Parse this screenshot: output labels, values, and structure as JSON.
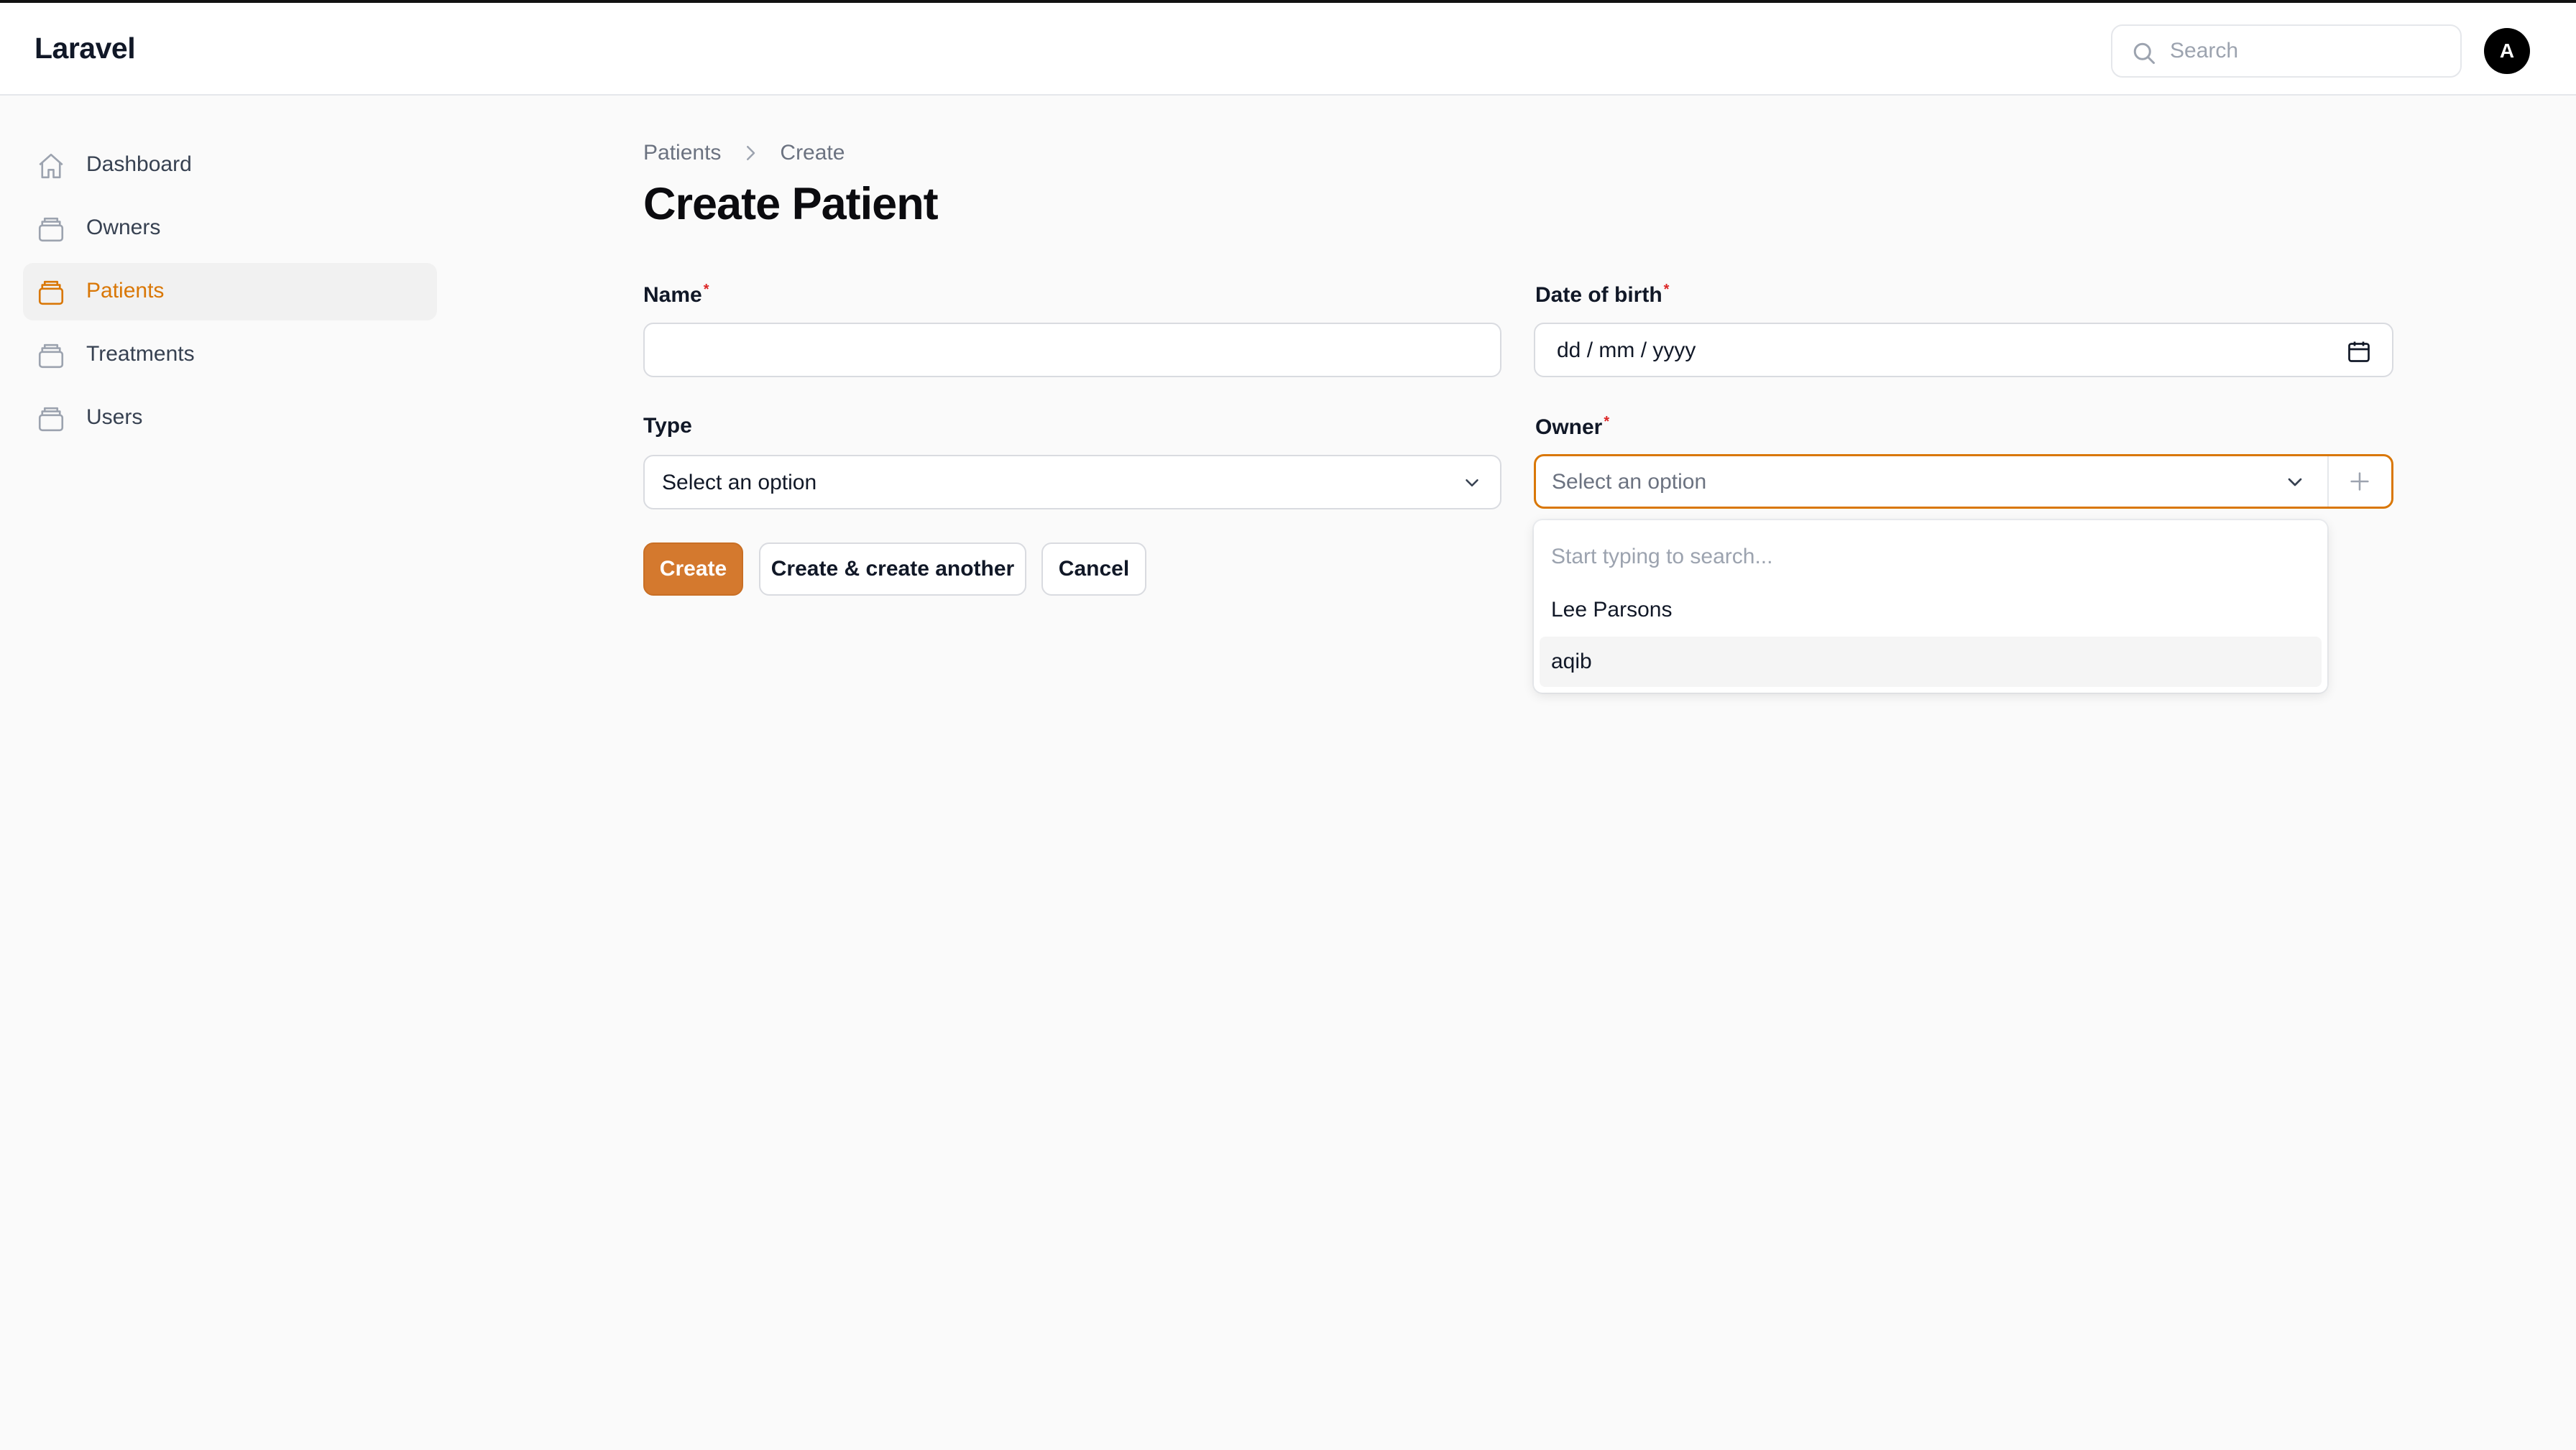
{
  "app": {
    "brand": "Laravel"
  },
  "topbar": {
    "search_placeholder": "Search",
    "avatar_initial": "A"
  },
  "sidebar": {
    "items": [
      {
        "label": "Dashboard",
        "icon": "home-icon",
        "active": false
      },
      {
        "label": "Owners",
        "icon": "inbox-stack-icon",
        "active": false
      },
      {
        "label": "Patients",
        "icon": "inbox-stack-icon",
        "active": true
      },
      {
        "label": "Treatments",
        "icon": "inbox-stack-icon",
        "active": false
      },
      {
        "label": "Users",
        "icon": "inbox-stack-icon",
        "active": false
      }
    ]
  },
  "breadcrumb": {
    "parent": "Patients",
    "current": "Create"
  },
  "page": {
    "title": "Create Patient"
  },
  "form": {
    "name": {
      "label": "Name",
      "required_mark": "*",
      "value": ""
    },
    "dob": {
      "label": "Date of birth",
      "required_mark": "*",
      "value": "dd / mm / yyyy"
    },
    "type": {
      "label": "Type",
      "value": "Select an option"
    },
    "owner": {
      "label": "Owner",
      "required_mark": "*",
      "placeholder": "Select an option",
      "dropdown": {
        "search_placeholder": "Start typing to search...",
        "options": [
          "Lee Parsons",
          "aqib"
        ]
      }
    }
  },
  "actions": {
    "create": "Create",
    "create_another": "Create & create another",
    "cancel": "Cancel"
  },
  "colors": {
    "accent": "#d97706",
    "primary_button": "#d4792e",
    "required": "#dc2626"
  }
}
